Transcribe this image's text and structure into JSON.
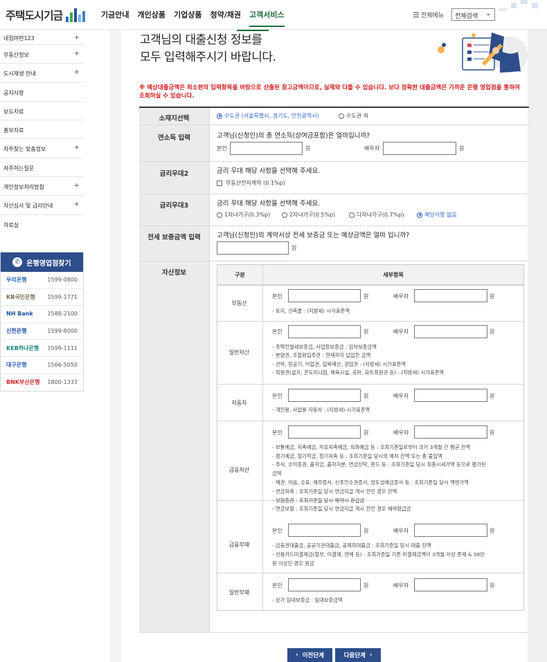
{
  "header": {
    "logo_text": "주택도시기금",
    "nav": [
      "기금안내",
      "개인상품",
      "기업상품",
      "청약/채권",
      "고객서비스"
    ],
    "all_menu": "전체메뉴",
    "search_select": "전체검색"
  },
  "sidebar": {
    "items": [
      {
        "label": "내집마련123",
        "plus": "+"
      },
      {
        "label": "부동산정보",
        "plus": "+"
      },
      {
        "label": "도시재생 안내",
        "plus": "+"
      },
      {
        "label": "공지사항",
        "plus": ""
      },
      {
        "label": "보도자료",
        "plus": ""
      },
      {
        "label": "홍보자료",
        "plus": ""
      },
      {
        "label": "자주찾는 맞춤정보",
        "plus": "+"
      },
      {
        "label": "자주하는질문",
        "plus": ""
      },
      {
        "label": "개인정보처리방침",
        "plus": "+"
      },
      {
        "label": "자산심사 및 금리안내",
        "plus": "+"
      },
      {
        "label": "자료실",
        "plus": ""
      }
    ],
    "bank_title": "은행영업점찾기",
    "banks": [
      {
        "name": "우리은행",
        "phone": "1599-0800",
        "color": "#1c63b7"
      },
      {
        "name": "KB국민은행",
        "phone": "1599-1771",
        "color": "#7a6a4a"
      },
      {
        "name": "NH Bank",
        "phone": "1588-2100",
        "color": "#1b4ea0"
      },
      {
        "name": "신한은행",
        "phone": "1599-8000",
        "color": "#1d4fa1"
      },
      {
        "name": "KEB하나은행",
        "phone": "1599-1111",
        "color": "#13887a"
      },
      {
        "name": "대구은행",
        "phone": "1566-5050",
        "color": "#2a5ab6"
      },
      {
        "name": "BNK부산은행",
        "phone": "1800-1333",
        "color": "#d02a2a"
      }
    ]
  },
  "page": {
    "title_line1": "고객님의 대출신청 정보를",
    "title_line2": "모두 입력해주시기 바랍니다.",
    "notice": "※ 예상대출금액은 최소한의 입력항목을 바탕으로 산출된 참고금액이므로, 실제와 다를 수 있습니다. 보다 정확한 대출금액은 가까운 은행 영업점을 통하여 조회하실 수 있습니다."
  },
  "form": {
    "location_label": "소재지선택",
    "location_opt1": "수도권 (서울특별시, 경기도, 인천광역시)",
    "location_opt2": "수도권 외",
    "income_label": "연소득 입력",
    "income_question": "고객님(신청인)의 총 연소득(상여금포함)은 얼마입니까?",
    "self": "본인",
    "spouse": "배우자",
    "won": "원",
    "rate2_label": "금리우대2",
    "rate_question": "금리 우대 해당 사항을 선택해 주세요.",
    "rate2_opt": "부동산전자계약 (0.1%p)",
    "rate3_label": "금리우대3",
    "rate3_opts": [
      "1자녀가구(0.3%p)",
      "2자녀가구(0.5%p)",
      "다자녀가구(0.7%p)",
      "해당사항 없음"
    ],
    "deposit_label": "전세 보증금액 입력",
    "deposit_question": "고객님(신청인)의 계약서상 전세 보증금 또는 예상금액은 얼마 입니까?",
    "asset_label": "자산정보",
    "asset_col1": "구분",
    "asset_col2": "세부항목"
  },
  "assets": [
    {
      "name": "부동산",
      "notes": [
        "- 토지, 건축물 : (지방세) 시가표준액"
      ]
    },
    {
      "name": "일반자산",
      "notes": [
        "- 주택전월세보증금, 사업장보증금 : 임차보증금액",
        "- 분양권, 조합원입주권 : 현재까지 납입한 금액",
        "- 선박, 항공기, 어업권, 입목재산, 광업권 : (지방세) 시가표준액",
        "- 회원권(골프, 콘도미니엄, 체육시설, 승마, 요트회원권 등) : (지방세) 시가표준액"
      ]
    },
    {
      "name": "자동차",
      "notes": [
        "- 개인용, 사업용 자동차 : (지방세) 시가표준액"
      ]
    },
    {
      "name": "금융자산",
      "notes": [
        "- 보통예금, 저축예금, 자유저축예금, 외화예금 등 : 조회기준일로부터 과거 3개월 간 평균 잔액",
        "- 정기예금, 정기적금, 정기저축 등 : 조회기준일 당시의 예치 잔액 또는 총 불입액",
        "- 주식, 수익증권, 출자금, 출자지분, 연금신탁, 펀드 등 : 조회기준일 당시 최종시세가액 등으로 평가된",
        "  금액",
        "- 채권, 어음, 수표, 채무증서, 신주인수권증서, 양도성예금증서 등 : 조회기준일 당시 액면가액",
        "- 연금저축 : 조회기준일 당시 연금지급 개시 전인 경우 잔액",
        "- 보험증권 : 조회기준일 당시 해약시 환급금",
        "- 연금보험 : 조회기준일 당시 연금지급 개시 전인 경우 해약환급금"
      ]
    },
    {
      "name": "금융부채",
      "notes": [
        "- 금융권대출금, 공공기관대출금, 공제회대출금 : 조회기준일 당시 대출 잔액",
        "- 신용카드미결제금(할부, 미결제, 연체 등) : 조회기준일 기준 미결제금액이 3개월 이상 존재 & 50만",
        "  원 이상인 경우 원금"
      ]
    },
    {
      "name": "일반부채",
      "notes": [
        "- 상가 임대보증금 : 임대보증금액"
      ]
    }
  ],
  "buttons": {
    "prev": "이전단계",
    "next": "다음단계"
  }
}
